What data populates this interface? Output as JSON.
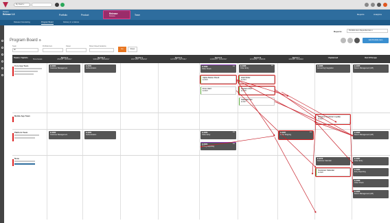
{
  "topbar": {
    "workspace_label": "My Dash ▾",
    "icons": [
      "help-icon",
      "notification-icon",
      "settings-icon",
      "user-avatar-icon"
    ]
  },
  "nav": {
    "release_small": "Release",
    "release_big": "Release 1.0",
    "portfolio": "Portfolio",
    "product": "Product",
    "release": "Release",
    "release_sub": "Release",
    "team": "Team",
    "reports": "Reports",
    "analytics": "Analytics"
  },
  "subnav": {
    "items": [
      "Release Forecasting",
      "Program Board",
      "Delivery in a Glance"
    ],
    "active_index": 1
  },
  "page": {
    "title": "Program Board",
    "reports_label": "Reports:",
    "reports_value": "Portfolio Item Dependencies",
    "add_button": "Add Portfolio Item"
  },
  "filters": {
    "team_label": "Team",
    "team_value": "All",
    "portfolio_label": "Portfolio Item",
    "owner_label": "Owner",
    "closed_label": "Show Closed Iterations",
    "go": "Go",
    "reset": "Reset"
  },
  "grid": {
    "team_header": "Teams / Sprints",
    "show_details": "Show Details",
    "columns": [
      {
        "name": "Sprint 1",
        "dates": "9/5/2017 - 9/25/2017"
      },
      {
        "name": "Sprint 2",
        "dates": "9/26/2017 - 10/16/2017"
      },
      {
        "name": "Sprint 3",
        "dates": "10/17/2017 - 11/6/2017"
      },
      {
        "name": "Sprint 4",
        "dates": "11/7/2017 - 11/27/2017"
      },
      {
        "name": "Sprint 5",
        "dates": "11/28/2017 - 12/18/2017"
      },
      {
        "name": "Sprint 6",
        "dates": "12/19/2017 - 1/8/2018"
      },
      {
        "name": "Sprint 7",
        "dates": "1/9/2018 - 1/29/2018"
      },
      {
        "name": "Unplanned",
        "dates": ""
      },
      {
        "name": "Out Of Scope",
        "dates": ""
      }
    ],
    "teams": [
      {
        "name": "Core App Team"
      },
      {
        "name": "Mobile App Team"
      },
      {
        "name": "Platform Team"
      },
      {
        "name": "None"
      }
    ]
  },
  "cards": [
    {
      "id": "E-0062",
      "name": "Customer Management",
      "pts": ""
    },
    {
      "id": "E-0061",
      "name": "Authentication",
      "pts": ""
    },
    {
      "id": "E-0089",
      "name": "Order Check",
      "pts": "8/8"
    },
    {
      "id": "E-0088",
      "name": "Order Entry",
      "pts": "8/8"
    },
    {
      "id": "E-0029",
      "name": "Alpha Status Check",
      "pts": ""
    },
    {
      "id": "E-0023",
      "name": "Error Alert",
      "pts": ""
    },
    {
      "id": "E-0024",
      "name": "Hold Order",
      "pts": ""
    },
    {
      "id": "E-0096",
      "name": "Capture Alert",
      "pts": ""
    },
    {
      "id": "E-0027",
      "name": "Calculate Tax",
      "pts": ""
    },
    {
      "id": "E-0086",
      "name": "Accounting Integration",
      "pts": ""
    },
    {
      "id": "E-0085",
      "name": "Return Management (API)",
      "pts": ""
    },
    {
      "id": "E-0029",
      "name": "Retrieve Customer Loyalty",
      "pts": ""
    },
    {
      "id": "E-0062",
      "name": "Customer Management",
      "pts": ""
    },
    {
      "id": "E-0061",
      "name": "Authentication",
      "pts": ""
    },
    {
      "id": "E-0083",
      "name": "Order Entry",
      "pts": "8/8"
    },
    {
      "id": "E-0084",
      "name": "Debug Reporting",
      "pts": "8/8"
    },
    {
      "id": "E-0087",
      "name": "Order Shipping",
      "pts": "8/8"
    },
    {
      "id": "E-0085",
      "name": "Return Management (API)",
      "pts": ""
    },
    {
      "id": "E-0072",
      "name": "Customer Calendar",
      "pts": ""
    },
    {
      "id": "E-0028",
      "name": "Customer Calendar",
      "pts": ""
    },
    {
      "id": "E-0087",
      "name": "Order Entry",
      "pts": ""
    },
    {
      "id": "E-0083",
      "name": "Entry Reporting",
      "pts": ""
    },
    {
      "id": "E-0089",
      "name": "Order Check",
      "pts": ""
    },
    {
      "id": "E-0085",
      "name": "Return Management (API)",
      "pts": ""
    }
  ]
}
